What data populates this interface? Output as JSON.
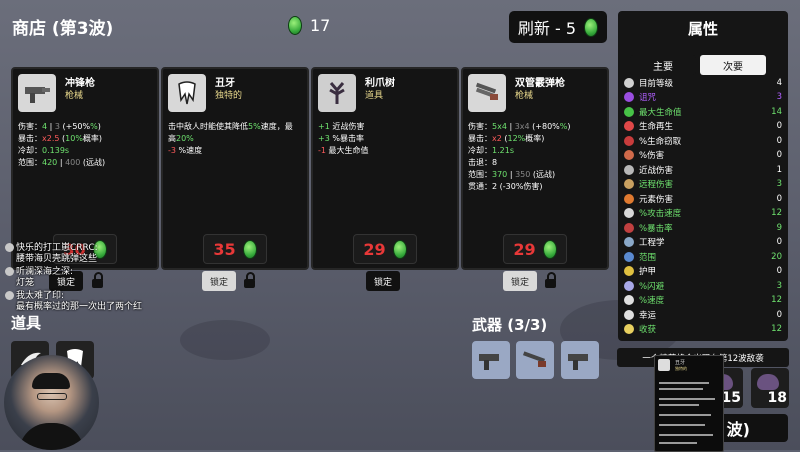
{
  "shop": {
    "title": "商店 (第3波)",
    "coins": "17",
    "refresh_label": "刷新 - 5"
  },
  "cards": [
    {
      "name": "冲锋枪",
      "type": "枪械",
      "stats": [
        [
          [
            "伤害：",
            ""
          ],
          [
            "4",
            "g"
          ],
          [
            " | ",
            ""
          ],
          [
            "3",
            "dim"
          ],
          [
            " (+50%",
            ""
          ],
          [
            "%",
            "g"
          ],
          [
            ")",
            ""
          ]
        ],
        [
          [
            "暴击：",
            ""
          ],
          [
            "x2.5",
            "r"
          ],
          [
            " (",
            ""
          ],
          [
            "10%",
            "g"
          ],
          [
            "概率)",
            ""
          ]
        ],
        [
          [
            "冷却：",
            ""
          ],
          [
            "0.139s",
            "g"
          ]
        ],
        [
          [
            "范围：",
            ""
          ],
          [
            "420",
            "g"
          ],
          [
            " | ",
            ""
          ],
          [
            "400",
            "dim"
          ],
          [
            " (远战)",
            ""
          ]
        ]
      ],
      "price": "30",
      "lock_label": "锁定"
    },
    {
      "name": "丑牙",
      "type": "独特的",
      "stats": [
        [
          [
            "击中敌人时能使其降低",
            ""
          ],
          [
            "5%",
            "g"
          ],
          [
            "速度，最",
            ""
          ]
        ],
        [
          [
            "高",
            ""
          ],
          [
            "20%",
            "g"
          ]
        ],
        [
          [
            "-3",
            "r"
          ],
          [
            " %速度",
            ""
          ]
        ]
      ],
      "price": "35",
      "lock_label": "锁定"
    },
    {
      "name": "利爪树",
      "type": "道具",
      "stats": [
        [
          [
            "+1",
            "g"
          ],
          [
            " 近战伤害",
            ""
          ]
        ],
        [
          [
            "+3",
            "g"
          ],
          [
            " %暴击率",
            ""
          ]
        ],
        [
          [
            "-1",
            "r"
          ],
          [
            " 最大生命值",
            ""
          ]
        ]
      ],
      "price": "29",
      "lock_label": "锁定"
    },
    {
      "name": "双管霰弹枪",
      "type": "枪械",
      "stats": [
        [
          [
            "伤害：",
            ""
          ],
          [
            "5x4",
            "g"
          ],
          [
            " | ",
            ""
          ],
          [
            "3x4",
            "dim"
          ],
          [
            " (+80%",
            ""
          ],
          [
            "%",
            "g"
          ],
          [
            ")",
            ""
          ]
        ],
        [
          [
            "暴击：",
            ""
          ],
          [
            "x2",
            "r"
          ],
          [
            " (",
            ""
          ],
          [
            "12%",
            "g"
          ],
          [
            "概率)",
            ""
          ]
        ],
        [
          [
            "冷却：",
            ""
          ],
          [
            "1.21s",
            "g"
          ]
        ],
        [
          [
            "击退：8",
            ""
          ]
        ],
        [
          [
            "范围：",
            ""
          ],
          [
            "370",
            "g"
          ],
          [
            " | ",
            ""
          ],
          [
            "350",
            "dim"
          ],
          [
            " (远战)",
            ""
          ]
        ],
        [
          [
            "贯通：2 (-30%伤害)",
            ""
          ]
        ]
      ],
      "price": "29",
      "lock_label": "锁定"
    }
  ],
  "items_section": {
    "title": "道具"
  },
  "weapons_section": {
    "title": "武器 (3/3)"
  },
  "stats_panel": {
    "title": "属性",
    "tabs": [
      "主要",
      "次要"
    ],
    "rows": [
      {
        "label": "目前等级",
        "value": "4",
        "color": "#ffffff",
        "icon": "#d0d0d0"
      },
      {
        "label": "诅咒",
        "value": "3",
        "color": "#b060ff",
        "icon": "#9a4ee0"
      },
      {
        "label": "最大生命值",
        "value": "14",
        "color": "#6fe36f",
        "icon": "#47c247"
      },
      {
        "label": "生命再生",
        "value": "0",
        "color": "#ffffff",
        "icon": "#e04848"
      },
      {
        "label": "%生命窃取",
        "value": "0",
        "color": "#ffffff",
        "icon": "#c83c3c"
      },
      {
        "label": "%伤害",
        "value": "0",
        "color": "#ffffff",
        "icon": "#d06a4a"
      },
      {
        "label": "近战伤害",
        "value": "1",
        "color": "#ffffff",
        "icon": "#b8b8b8"
      },
      {
        "label": "远程伤害",
        "value": "3",
        "color": "#6fe36f",
        "icon": "#c8a060"
      },
      {
        "label": "元素伤害",
        "value": "0",
        "color": "#ffffff",
        "icon": "#e07a30"
      },
      {
        "label": "%攻击速度",
        "value": "12",
        "color": "#6fe36f",
        "icon": "#d8d8d8"
      },
      {
        "label": "%暴击率",
        "value": "9",
        "color": "#6fe36f",
        "icon": "#c04040"
      },
      {
        "label": "工程学",
        "value": "0",
        "color": "#ffffff",
        "icon": "#8aa8c8"
      },
      {
        "label": "范围",
        "value": "20",
        "color": "#6fe36f",
        "icon": "#5a8ad0"
      },
      {
        "label": "护甲",
        "value": "0",
        "color": "#ffffff",
        "icon": "#e0c040"
      },
      {
        "label": "%闪避",
        "value": "3",
        "color": "#6fe36f",
        "icon": "#a8a8e8"
      },
      {
        "label": "%速度",
        "value": "12",
        "color": "#6fe36f",
        "icon": "#e0e0e0"
      },
      {
        "label": "幸运",
        "value": "0",
        "color": "#ffffff",
        "icon": "#e0e0e0"
      },
      {
        "label": "收获",
        "value": "12",
        "color": "#6fe36f",
        "icon": "#e8d060"
      }
    ]
  },
  "banner": "一个精英将会出现在第12波敌袭",
  "enemies": [
    "15",
    "18"
  ],
  "go_button": "波)",
  "tooltip": {
    "name": "丑牙",
    "type": "独特的"
  },
  "chat": [
    {
      "user": "快乐的打工崽CRRC:",
      "text": "腰带海贝壳跳弹这些"
    },
    {
      "user": "听澜深海之深:",
      "text": "灯笼"
    },
    {
      "user": "我太难了印:",
      "text": "最有概率过的那一次出了两个红"
    }
  ]
}
